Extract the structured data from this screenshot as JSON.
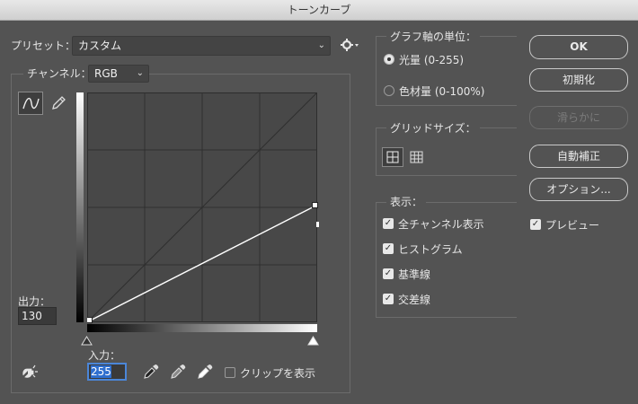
{
  "window": {
    "title": "トーンカーブ"
  },
  "preset": {
    "label": "プリセット：",
    "value": "カスタム"
  },
  "channel": {
    "label": "チャンネル：",
    "value": "RGB"
  },
  "output": {
    "label": "出力：",
    "value": "130"
  },
  "input": {
    "label": "入力：",
    "value": "255"
  },
  "clip": {
    "label": "クリップを表示",
    "checked": false
  },
  "graph_units": {
    "title": "グラフ軸の単位：",
    "options": [
      {
        "label": "光量 (0-255)",
        "selected": true
      },
      {
        "label": "色材量 (0-100%)",
        "selected": false
      }
    ]
  },
  "grid_size": {
    "title": "グリッドサイズ：",
    "selected": "4x4"
  },
  "display": {
    "title": "表示：",
    "options": [
      {
        "label": "全チャンネル表示",
        "checked": true
      },
      {
        "label": "ヒストグラム",
        "checked": true
      },
      {
        "label": "基準線",
        "checked": true
      },
      {
        "label": "交差線",
        "checked": true
      }
    ]
  },
  "buttons": {
    "ok": "OK",
    "reset": "初期化",
    "smooth": "滑らかに",
    "auto": "自動補正",
    "options": "オプション..."
  },
  "preview": {
    "label": "プレビュー",
    "checked": true
  },
  "curve": {
    "points": [
      [
        0,
        0
      ],
      [
        255,
        130
      ]
    ],
    "range": [
      0,
      255
    ]
  },
  "colors": {
    "accent": "#2f6fcf",
    "panel": "#535353",
    "graph_bg": "#484848"
  }
}
